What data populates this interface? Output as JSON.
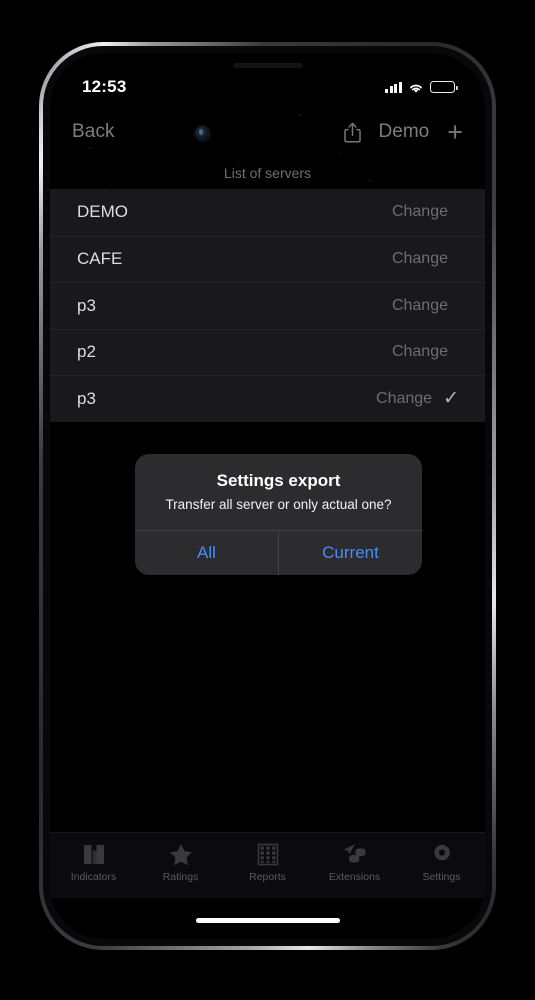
{
  "status_bar": {
    "time": "12:53",
    "cellular_icon": "cellular-signal-icon",
    "wifi_icon": "wifi-icon",
    "battery_icon": "battery-icon"
  },
  "nav_bar": {
    "back_label": "Back",
    "share_icon": "share-icon",
    "title": "Demo",
    "add_label": "+"
  },
  "section_header": "List of servers",
  "servers": [
    {
      "name": "DEMO",
      "action_label": "Change",
      "selected": false,
      "check_glyph": ""
    },
    {
      "name": "CAFE",
      "action_label": "Change",
      "selected": false,
      "check_glyph": ""
    },
    {
      "name": "p3",
      "action_label": "Change",
      "selected": false,
      "check_glyph": ""
    },
    {
      "name": "p2",
      "action_label": "Change",
      "selected": false,
      "check_glyph": ""
    },
    {
      "name": "p3",
      "action_label": "Change",
      "selected": true,
      "check_glyph": "✓"
    }
  ],
  "alert": {
    "title": "Settings export",
    "message": "Transfer all server or only actual one?",
    "buttons": [
      {
        "label": "All"
      },
      {
        "label": "Current"
      }
    ],
    "accent_color": "#4a8cf7"
  },
  "tab_bar": {
    "items": [
      {
        "label": "Indicators",
        "icon": "bar-chart-icon"
      },
      {
        "label": "Ratings",
        "icon": "star-icon"
      },
      {
        "label": "Reports",
        "icon": "grid-icon"
      },
      {
        "label": "Extensions",
        "icon": "paper-plane-coins-icon"
      },
      {
        "label": "Settings",
        "icon": "gear-icon"
      }
    ]
  },
  "colors": {
    "screen_background": "#000000",
    "list_background": "#19191b",
    "alert_background": "#2c2c2e",
    "accent_blue": "#4a8cf7",
    "primary_text": "#dedee0",
    "secondary_text": "#6d6d70"
  }
}
